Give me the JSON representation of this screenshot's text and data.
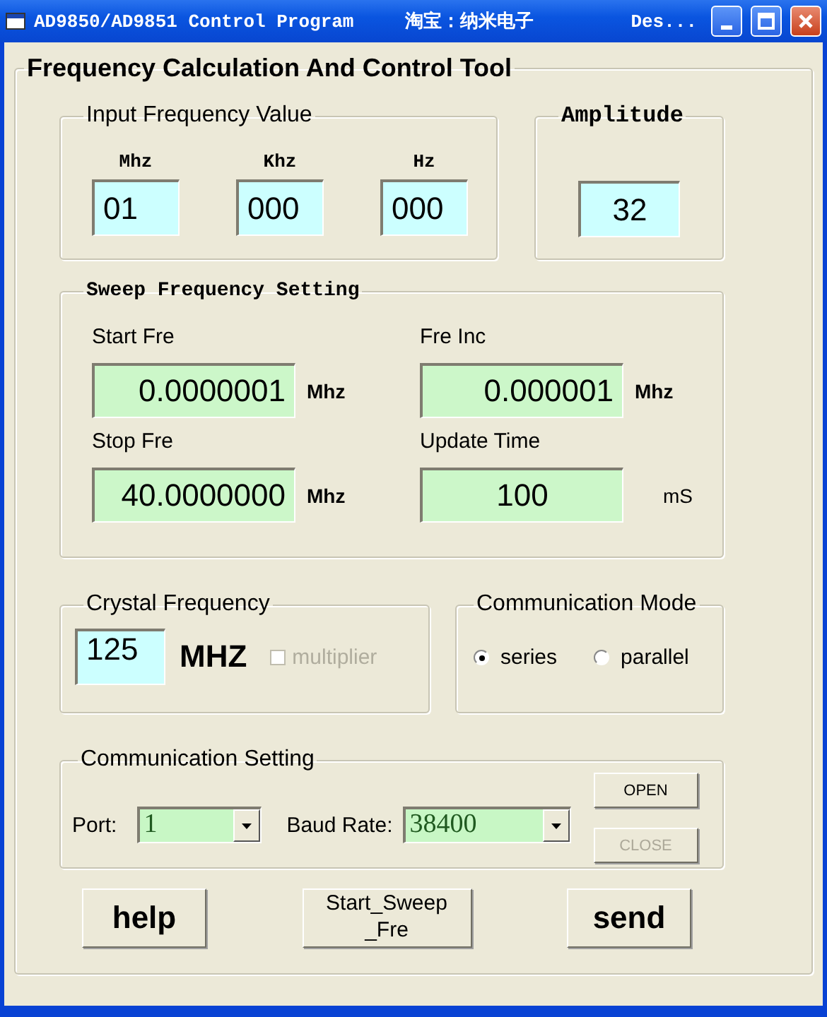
{
  "window": {
    "title": "AD9850/AD9851 Control Program",
    "vendor": "淘宝：纳米电子",
    "title_tail": "Des..."
  },
  "main_group": {
    "title": "Frequency Calculation And Control Tool"
  },
  "input_frequency": {
    "title": "Input Frequency Value",
    "fields": [
      {
        "label": "Mhz",
        "value": "01"
      },
      {
        "label": "Khz",
        "value": "000"
      },
      {
        "label": "Hz",
        "value": "000"
      }
    ]
  },
  "amplitude": {
    "title": "Amplitude",
    "value": "32"
  },
  "sweep": {
    "title": "Sweep Frequency Setting",
    "fields": [
      {
        "label": "Start Fre",
        "value": "0.0000001",
        "unit": "Mhz",
        "kind": "frequency"
      },
      {
        "label": "Fre Inc",
        "value": "0.000001",
        "unit": "Mhz",
        "kind": "frequency"
      },
      {
        "label": "Stop Fre",
        "value": "40.0000000",
        "unit": "Mhz",
        "kind": "frequency"
      },
      {
        "label": "Update Time",
        "value": "100",
        "unit": "mS",
        "kind": "time"
      }
    ]
  },
  "crystal": {
    "title": "Crystal Frequency",
    "value": "125",
    "unit": "MHZ",
    "multiplier": {
      "label": "multiplier",
      "checked": false,
      "disabled": true
    }
  },
  "communication_mode": {
    "title": "Communication Mode",
    "options": [
      {
        "label": "series",
        "selected": true
      },
      {
        "label": "parallel",
        "selected": false
      }
    ]
  },
  "communication_setting": {
    "title": "Communication Setting",
    "port": {
      "label": "Port:",
      "value": "1"
    },
    "baud_rate": {
      "label": "Baud Rate:",
      "value": "38400"
    },
    "buttons": [
      {
        "label": "OPEN",
        "disabled": false
      },
      {
        "label": "CLOSE",
        "disabled": true
      }
    ]
  },
  "actions": [
    {
      "lines": [
        "help"
      ],
      "kind": "large"
    },
    {
      "lines": [
        "Start_Sweep",
        "_Fre"
      ],
      "kind": "small"
    },
    {
      "lines": [
        "send"
      ],
      "kind": "large"
    }
  ]
}
